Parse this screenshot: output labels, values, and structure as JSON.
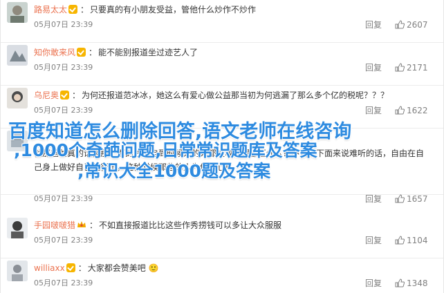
{
  "comments": [
    {
      "user": "路易太太",
      "badge": "vip",
      "content": "只要真的有小朋友受益，管他什么炒作不炒作",
      "time": "05月07日 23:39",
      "reply": "回复",
      "likes": "2607"
    },
    {
      "user": "知你敢来风",
      "badge": "vip",
      "content": "能不能别报道坐过迹艺人了",
      "time": "05月07日 23:39",
      "reply": "回复",
      "likes": "2171"
    },
    {
      "user": "乌尼奥",
      "badge": "vip",
      "content": "为何还报道范冰冰，她这么有爱心做公益那当初为何逃漏了那么多个亿的税呢？？？",
      "time": "05月07日 23:39",
      "reply": "回复",
      "likes": "1622"
    },
    {
      "user": "",
      "badge": "",
      "content": "就那爸爸真的话被那个面的钱，自到时候来的人都被收都得都正什么？不要在下面来说难听的话，自由在自己身上做好自己就行了，这种时候那些的人为你担心！",
      "time": "05月07日 23:39",
      "reply": "回复",
      "likes": "1657"
    },
    {
      "user": "手园啵啵猎",
      "badge": "crown",
      "content": "不如直接报道比比这些作秀捞钱可以多让大众服服",
      "time": "05月07日 23:39",
      "reply": "回复",
      "likes": "1104"
    },
    {
      "user": "williaxx",
      "badge": "vip",
      "content": "大家都会赞美吧 🙂",
      "time": "05月07日 23:39",
      "reply": "回复",
      "likes": "1348"
    }
  ],
  "overlay": {
    "line1": "百度知道怎么删除回答,语文老师在线咨询",
    "line2": ",1000个奇葩问题,日常常识题库及答案",
    "line3": ",常识大全1000题及答案"
  },
  "colors": {
    "username": "#eb7350",
    "overlay": "#2e8be0",
    "meta": "#808080"
  }
}
